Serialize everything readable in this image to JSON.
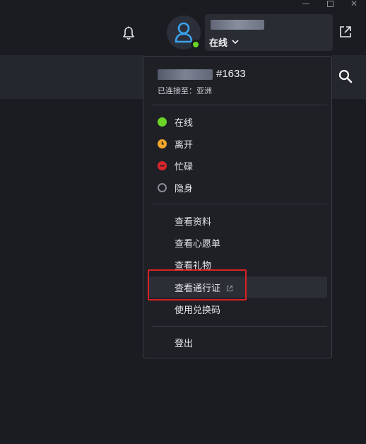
{
  "window": {
    "minimize_label": "",
    "maximize_label": "",
    "close_label": "✕"
  },
  "header": {
    "profile_status": "在线"
  },
  "menu": {
    "user_tag": "#1633",
    "connected_label": "已连接至：亚洲",
    "statuses": [
      {
        "label": "在线",
        "color": "#6ad526"
      },
      {
        "label": "离开",
        "color": "#f2a72b"
      },
      {
        "label": "忙碌",
        "color": "#d9262b"
      },
      {
        "label": "隐身",
        "color": "#8a8c94"
      }
    ],
    "actions": [
      {
        "label": "查看资料"
      },
      {
        "label": "查看心愿单"
      },
      {
        "label": "查看礼物"
      },
      {
        "label": "查看通行证"
      },
      {
        "label": "使用兑换码"
      }
    ],
    "logout_label": "登出"
  },
  "colors": {
    "accent_online": "#6ad526",
    "highlight": "#d92124"
  }
}
